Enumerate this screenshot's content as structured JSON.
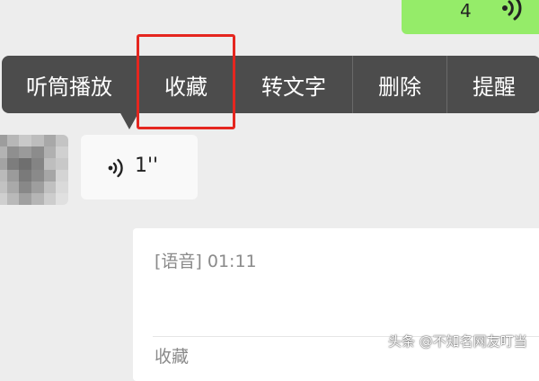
{
  "outgoing_voice": {
    "duration": "4"
  },
  "context_menu": {
    "items": [
      {
        "label": "听筒播放"
      },
      {
        "label": "收藏"
      },
      {
        "label": "转文字"
      },
      {
        "label": "删除"
      },
      {
        "label": "提醒"
      }
    ],
    "highlighted_item": "收藏",
    "highlight_color": "#e5261f"
  },
  "incoming_voice": {
    "duration": "1''"
  },
  "favorite_card": {
    "text": "[语音] 01:11",
    "footer": "收藏"
  },
  "watermark": {
    "text": "头条 @不知名网友叮当"
  },
  "colors": {
    "outgoing_bubble": "#95ec69",
    "menu_background": "#4c4c4c",
    "chat_background": "#ededed"
  },
  "icons": [
    "voice-wave-icon",
    "voice-wave-icon",
    "avatar-pixelated"
  ]
}
